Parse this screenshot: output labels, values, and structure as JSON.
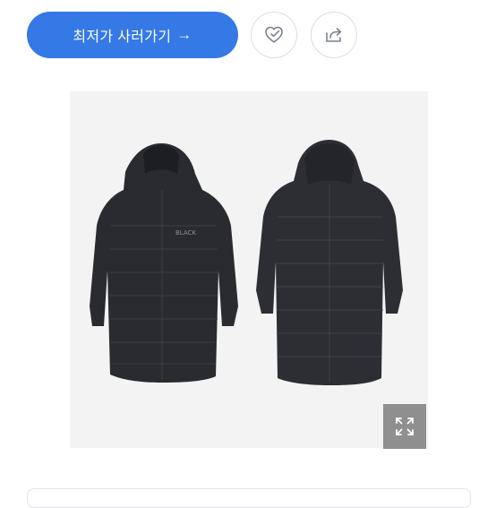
{
  "action_bar": {
    "cta_label": "최저가 사러가기",
    "cta_arrow": "→",
    "wishlist_icon": "heart-check-icon",
    "share_icon": "share-icon"
  },
  "product": {
    "image_alt": "",
    "front_logo": "BLACK",
    "zoom_icon": "expand-icon"
  },
  "colors": {
    "accent": "#3479e5",
    "zoom_bg": "#8f8f8f",
    "coat": "#2a2b2f"
  }
}
